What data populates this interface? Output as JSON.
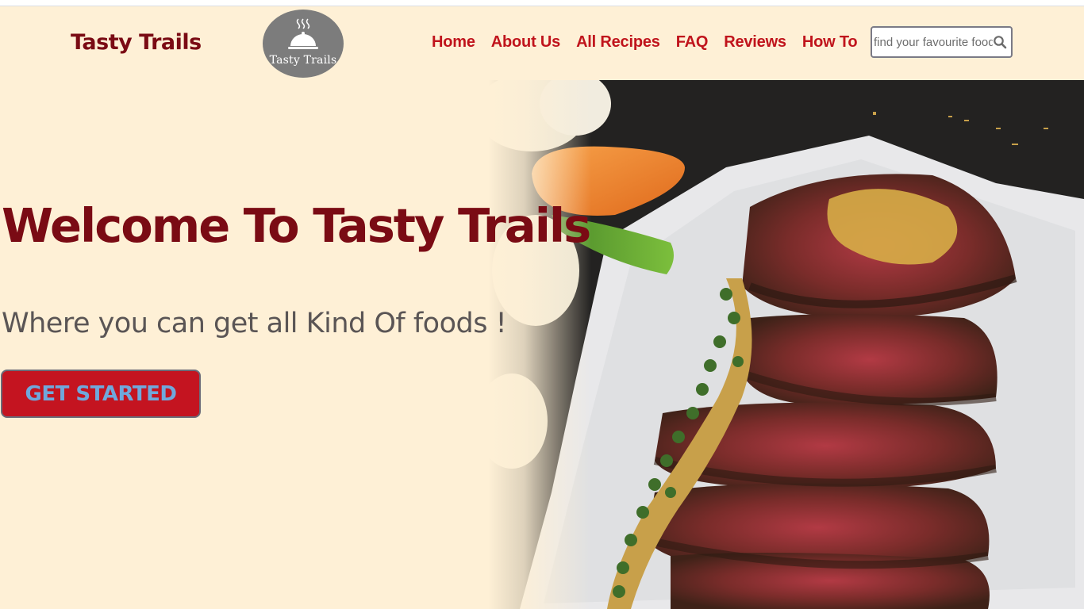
{
  "header": {
    "brand": "Tasty Trails",
    "logo_text": "Tasty Trails",
    "nav": [
      {
        "label": "Home"
      },
      {
        "label": "About Us"
      },
      {
        "label": "All Recipes"
      },
      {
        "label": "FAQ"
      },
      {
        "label": "Reviews"
      },
      {
        "label": "How To"
      }
    ],
    "search": {
      "placeholder": "find your favourite food",
      "value": "",
      "icon": "search-icon"
    }
  },
  "hero": {
    "title": "Welcome To Tasty Trails",
    "subtitle": "Where you can get all Kind Of foods !",
    "cta_label": "GET STARTED",
    "image_subject": "sliced steak with green peppercorn sauce, carrot and beans on parchment paper"
  },
  "colors": {
    "background": "#fef0d6",
    "brand": "#7a0b14",
    "nav": "#c0141c",
    "cta_bg": "#c41420",
    "cta_text": "#6fa8dc",
    "subtitle": "#5a5555"
  }
}
